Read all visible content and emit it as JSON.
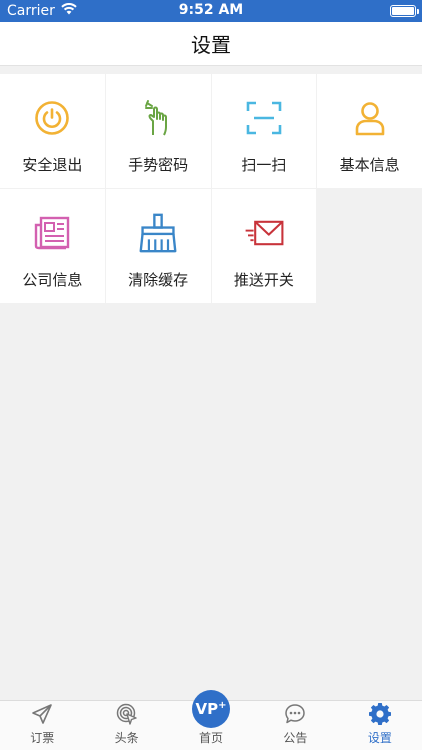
{
  "status_bar": {
    "carrier": "Carrier",
    "time": "9:52 AM",
    "battery_level": 1.0
  },
  "nav": {
    "title": "设置"
  },
  "grid": {
    "items": [
      {
        "label": "安全退出",
        "icon": "power-icon",
        "color": "#f2b234"
      },
      {
        "label": "手势密码",
        "icon": "gesture-icon",
        "color": "#6aa544"
      },
      {
        "label": "扫一扫",
        "icon": "scan-icon",
        "color": "#4ab7e1"
      },
      {
        "label": "基本信息",
        "icon": "user-icon",
        "color": "#f2b234"
      },
      {
        "label": "公司信息",
        "icon": "newspaper-icon",
        "color": "#d360b0"
      },
      {
        "label": "清除缓存",
        "icon": "broom-icon",
        "color": "#3a86c8"
      },
      {
        "label": "推送开关",
        "icon": "mail-icon",
        "color": "#c8333a"
      }
    ]
  },
  "tab_bar": {
    "tabs": [
      {
        "label": "订票",
        "icon": "paper-plane-icon",
        "active": false
      },
      {
        "label": "头条",
        "icon": "radar-icon",
        "active": false
      },
      {
        "label": "首页",
        "icon": "vp-home-icon",
        "active": false,
        "badge_text": "VP"
      },
      {
        "label": "公告",
        "icon": "chat-bubble-icon",
        "active": false
      },
      {
        "label": "设置",
        "icon": "gear-icon",
        "active": true
      }
    ],
    "active_color": "#2f6fc8"
  }
}
